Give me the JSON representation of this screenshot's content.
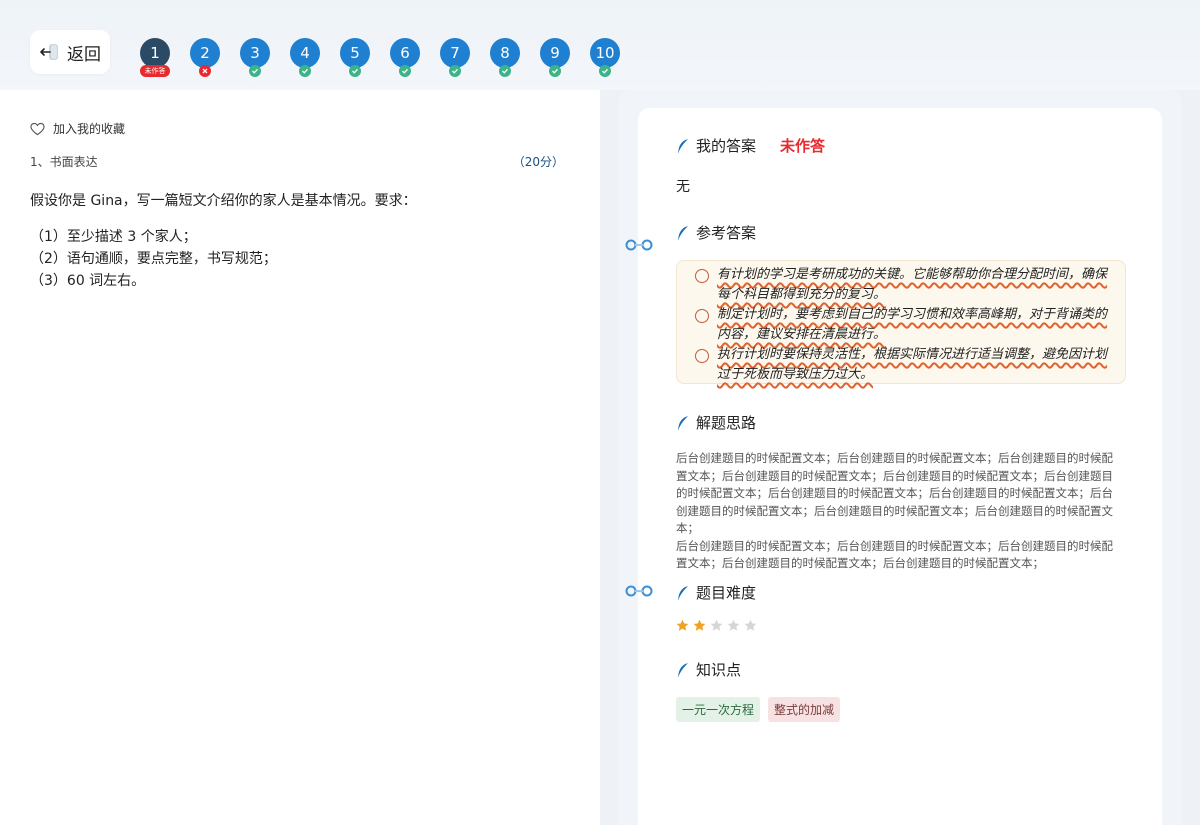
{
  "header": {
    "back_label": "返回",
    "questions": [
      {
        "num": "1",
        "status": "unanswered",
        "badge": "未作答"
      },
      {
        "num": "2",
        "status": "wrong"
      },
      {
        "num": "3",
        "status": "correct"
      },
      {
        "num": "4",
        "status": "correct"
      },
      {
        "num": "5",
        "status": "correct"
      },
      {
        "num": "6",
        "status": "correct"
      },
      {
        "num": "7",
        "status": "correct"
      },
      {
        "num": "8",
        "status": "correct"
      },
      {
        "num": "9",
        "status": "correct"
      },
      {
        "num": "10",
        "status": "correct"
      }
    ]
  },
  "question": {
    "favorite_label": "加入我的收藏",
    "title": "1、书面表达",
    "score": "（20分）",
    "body": "假设你是 Gina，写一篇短文介绍你的家人是基本情况。要求：",
    "requirements": [
      "（1）至少描述 3 个家人；",
      "（2）语句通顺，要点完整，书写规范；",
      "（3）60 词左右。"
    ]
  },
  "answer_panel": {
    "my_answer_heading": "我的答案",
    "my_answer_status": "未作答",
    "my_answer_value": "无",
    "reference_heading": "参考答案",
    "reference_items": [
      "有计划的学习是考研成功的关键。它能够帮助你合理分配时间，确保每个科目都得到充分的复习。",
      "制定计划时，要考虑到自己的学习习惯和效率高峰期，对于背诵类的内容，建议安排在清晨进行。",
      "执行计划时要保持灵活性，根据实际情况进行适当调整，避免因计划过于死板而导致压力过大。"
    ],
    "analysis_heading": "解题思路",
    "analysis_paragraphs": [
      "后台创建题目的时候配置文本；后台创建题目的时候配置文本；后台创建题目的时候配置文本；后台创建题目的时候配置文本；后台创建题目的时候配置文本；后台创建题目的时候配置文本；后台创建题目的时候配置文本；后台创建题目的时候配置文本；后台创建题目的时候配置文本；后台创建题目的时候配置文本；后台创建题目的时候配置文本；",
      "后台创建题目的时候配置文本；后台创建题目的时候配置文本；后台创建题目的时候配置文本；后台创建题目的时候配置文本；后台创建题目的时候配置文本；"
    ],
    "difficulty_heading": "题目难度",
    "difficulty": {
      "rating": 2,
      "max": 5
    },
    "knowledge_heading": "知识点",
    "knowledge_tags": [
      "一元一次方程",
      "整式的加减"
    ]
  },
  "colors": {
    "accent_blue": "#1f7fd0",
    "current_question": "#2a4a66",
    "error_red": "#e8292d",
    "correct_green": "#3db487",
    "star_filled": "#f0a223",
    "star_empty": "#d6d6d6"
  }
}
